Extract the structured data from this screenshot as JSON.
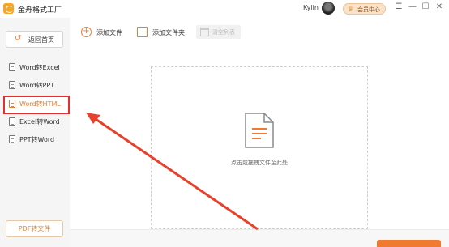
{
  "app": {
    "title": "金舟格式工厂",
    "user_name": "Kylin",
    "vip_label": "会员中心"
  },
  "window_controls": [
    "☰",
    "—",
    "☐",
    "✕"
  ],
  "sidebar": {
    "back_label": "返回首页",
    "items": [
      {
        "label": "Word转Excel",
        "active": false
      },
      {
        "label": "Word转PPT",
        "active": false
      },
      {
        "label": "Word转HTML",
        "active": true
      },
      {
        "label": "Excel转Word",
        "active": false
      },
      {
        "label": "PPT转Word",
        "active": false
      }
    ],
    "bottom_button": "PDF转文件"
  },
  "toolbar": {
    "add_file": "添加文件",
    "add_folder": "添加文件夹",
    "clear_list": "清空列表"
  },
  "dropzone": {
    "hint": "点击或拖拽文件至此处"
  },
  "colors": {
    "accent": "#f07a30",
    "highlight_border": "#e03030",
    "arrow": "#e8402a"
  },
  "icons": [
    "app-logo-icon",
    "avatar",
    "vip-icon",
    "back-arrow-icon",
    "document-icon",
    "plus-circle-icon",
    "folder-icon",
    "trash-icon"
  ]
}
